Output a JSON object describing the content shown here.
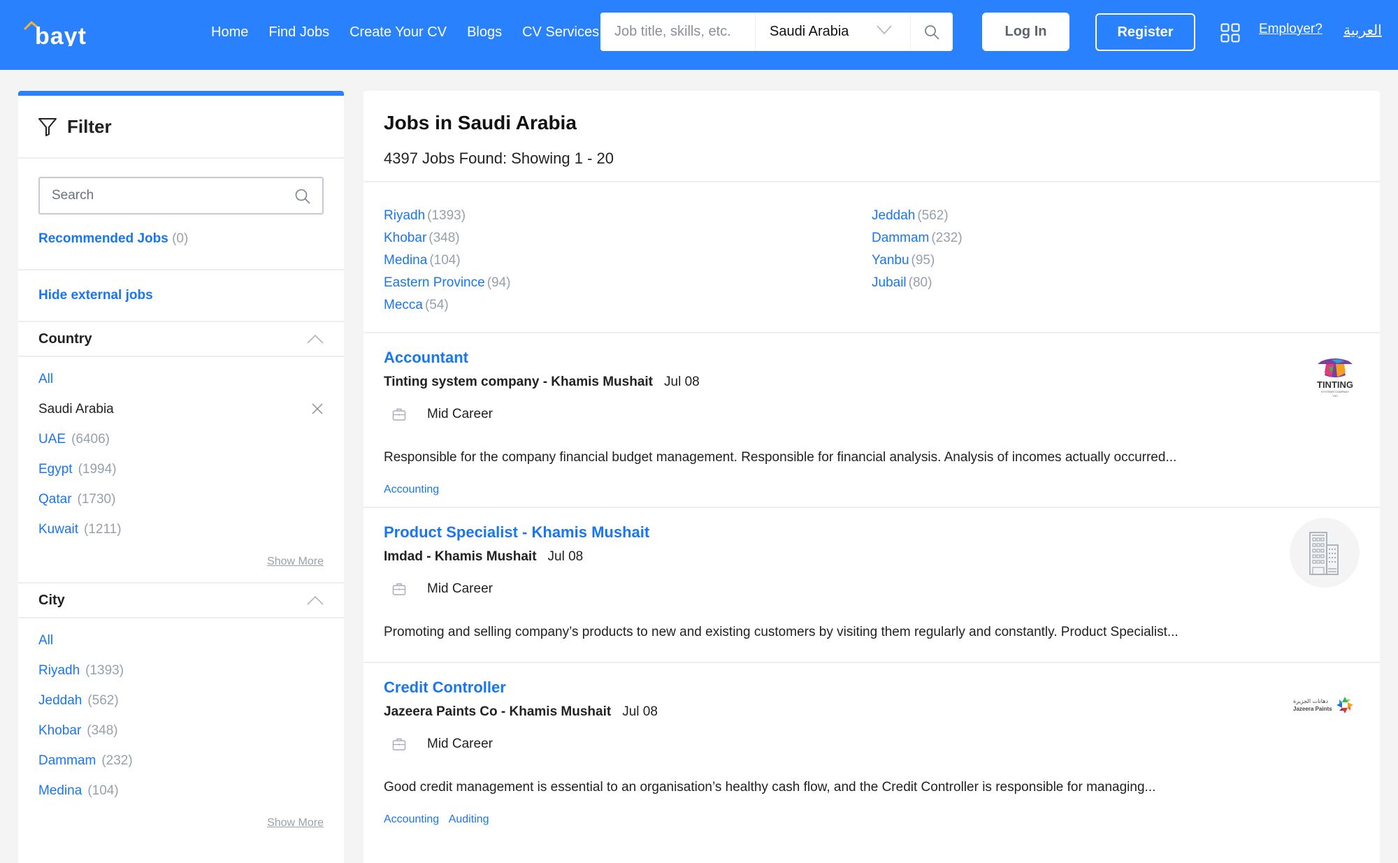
{
  "header": {
    "logo_text": "bayt",
    "nav": [
      "Home",
      "Find Jobs",
      "Create Your CV",
      "Blogs",
      "CV Services"
    ],
    "search_placeholder": "Job title, skills, etc.",
    "search_value": "",
    "country_selected": "Saudi Arabia",
    "login_label": "Log In",
    "register_label": "Register",
    "employer_label": "Employer?",
    "language_label": "العربية",
    "brand_color": "#2981fe",
    "logo_accent_color": "#f5b52e"
  },
  "sidebar": {
    "title": "Filter",
    "search_placeholder": "Search",
    "recommended": {
      "label": "Recommended Jobs",
      "count": "(0)"
    },
    "hide_external": "Hide external jobs",
    "country": {
      "title": "Country",
      "all_label": "All",
      "selected": "Saudi Arabia",
      "options": [
        {
          "name": "UAE",
          "count": "(6406)"
        },
        {
          "name": "Egypt",
          "count": "(1994)"
        },
        {
          "name": "Qatar",
          "count": "(1730)"
        },
        {
          "name": "Kuwait",
          "count": "(1211)"
        }
      ],
      "show_more": "Show More"
    },
    "city": {
      "title": "City",
      "all_label": "All",
      "options": [
        {
          "name": "Riyadh",
          "count": "(1393)"
        },
        {
          "name": "Jeddah",
          "count": "(562)"
        },
        {
          "name": "Khobar",
          "count": "(348)"
        },
        {
          "name": "Dammam",
          "count": "(232)"
        },
        {
          "name": "Medina",
          "count": "(104)"
        }
      ],
      "show_more": "Show More"
    }
  },
  "main": {
    "title": "Jobs in Saudi Arabia",
    "subtitle": "4397 Jobs Found: Showing 1 - 20",
    "cities_left": [
      {
        "name": "Riyadh",
        "count": "(1393)"
      },
      {
        "name": "Khobar",
        "count": "(348)"
      },
      {
        "name": "Medina",
        "count": "(104)"
      },
      {
        "name": "Eastern Province",
        "count": "(94)"
      },
      {
        "name": "Mecca",
        "count": "(54)"
      }
    ],
    "cities_right": [
      {
        "name": "Jeddah",
        "count": "(562)"
      },
      {
        "name": "Dammam",
        "count": "(232)"
      },
      {
        "name": "Yanbu",
        "count": "(95)"
      },
      {
        "name": "Jubail",
        "count": "(80)"
      }
    ],
    "jobs": [
      {
        "title": "Accountant",
        "company": "Tinting system company - Khamis Mushait",
        "date": "Jul 08",
        "level": "Mid Career",
        "description": "Responsible for the company financial budget management. Responsible for financial analysis. Analysis of incomes actually occurred...",
        "tags": [
          "Accounting"
        ],
        "logo": {
          "type": "tinting",
          "text": "TINTING",
          "subtext": "SYSTEMS COMPANY",
          "subtext2": "TSC"
        }
      },
      {
        "title": "Product Specialist - Khamis Mushait",
        "company": "Imdad - Khamis Mushait",
        "date": "Jul 08",
        "level": "Mid Career",
        "description": "Promoting and selling company’s products to new and existing customers by visiting them regularly and constantly. Product Specialist...",
        "tags": [],
        "logo": {
          "type": "placeholder-building"
        }
      },
      {
        "title": "Credit Controller",
        "company": "Jazeera Paints Co - Khamis Mushait",
        "date": "Jul 08",
        "level": "Mid Career",
        "description": "Good credit management is essential to an organisation’s healthy cash flow, and the Credit Controller is responsible for managing...",
        "tags": [
          "Accounting",
          "Auditing"
        ],
        "logo": {
          "type": "jazeera",
          "text": "Jazeera Paints",
          "arabic": "دهانات الجزيرة"
        }
      }
    ]
  }
}
